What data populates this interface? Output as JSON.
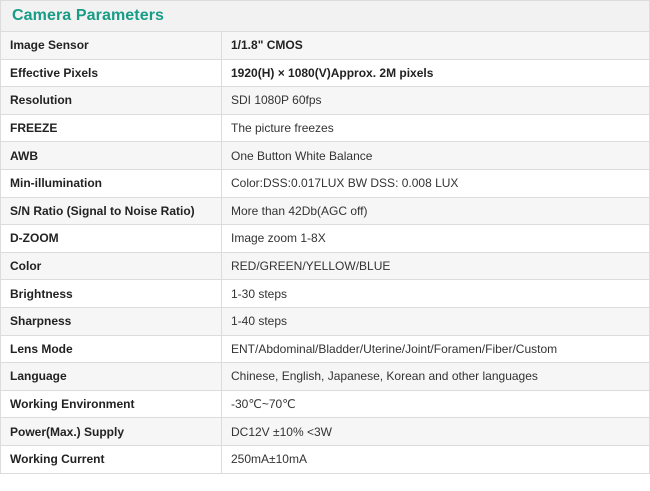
{
  "section": {
    "title": "Camera Parameters"
  },
  "rows": [
    {
      "label": "Image Sensor",
      "value": "1/1.8\" CMOS"
    },
    {
      "label": "Effective Pixels",
      "value": "1920(H) × 1080(V)Approx. 2M pixels"
    },
    {
      "label": "Resolution",
      "value": "SDI 1080P 60fps"
    },
    {
      "label": "FREEZE",
      "value": "The picture freezes"
    },
    {
      "label": "AWB",
      "value": "One Button White Balance"
    },
    {
      "label": "Min-illumination",
      "value": "Color:DSS:0.017LUX BW DSS: 0.008 LUX"
    },
    {
      "label": "S/N Ratio (Signal to Noise Ratio)",
      "value": "More than 42Db(AGC off)"
    },
    {
      "label": "D-ZOOM",
      "value": "Image zoom 1-8X"
    },
    {
      "label": "Color",
      "value": "RED/GREEN/YELLOW/BLUE"
    },
    {
      "label": "Brightness",
      "value": "1-30 steps"
    },
    {
      "label": "Sharpness",
      "value": "1-40 steps"
    },
    {
      "label": "Lens Mode",
      "value": "ENT/Abdominal/Bladder/Uterine/Joint/Foramen/Fiber/Custom"
    },
    {
      "label": "Language",
      "value": "Chinese, English, Japanese, Korean and other languages"
    },
    {
      "label": "Working Environment",
      "value": "-30℃~70℃"
    },
    {
      "label": "Power(Max.) Supply",
      "value": "DC12V ±10% <3W"
    },
    {
      "label": "Working Current",
      "value": "250mA±10mA"
    }
  ],
  "colors": {
    "title": "#179c86",
    "border": "#dcdcdc",
    "row_alt": "#f6f6f6"
  }
}
